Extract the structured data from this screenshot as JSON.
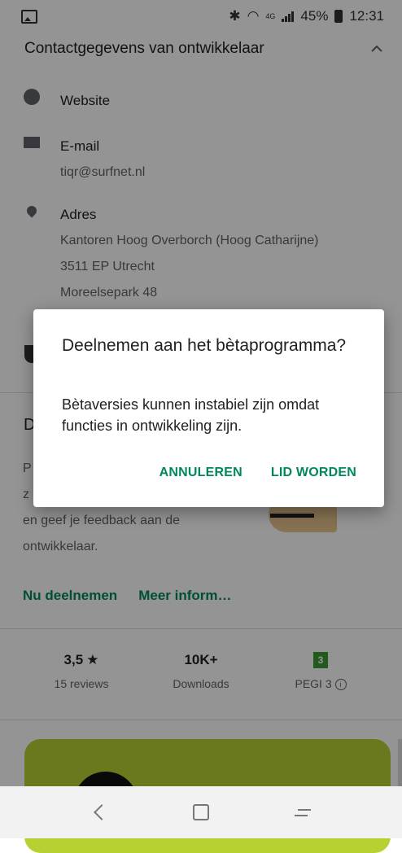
{
  "status_bar": {
    "time": "12:31",
    "battery_percent": "45%",
    "network_type": "4G"
  },
  "contact": {
    "section_title": "Contactgegevens van ontwikkelaar",
    "website_label": "Website",
    "email_label": "E-mail",
    "email_value": "tiqr@surfnet.nl",
    "address_label": "Adres",
    "address_lines": [
      "Kantoren Hoog Overborch (Hoog Catharijne)",
      "3511 EP Utrecht",
      "Moreelsepark 48"
    ]
  },
  "beta": {
    "title_partial": "D",
    "text_lines": [
      "P",
      "z",
      "en geef je feedback aan de",
      "ontwikkelaar."
    ],
    "join_link": "Nu deelnemen",
    "more_link": "Meer inform…"
  },
  "stats": [
    {
      "value": "3,5",
      "label": "15 reviews",
      "icon": "star-icon"
    },
    {
      "value": "10K+",
      "label": "Downloads"
    },
    {
      "value": "3",
      "label": "PEGI 3",
      "icon": "info-icon"
    }
  ],
  "dialog": {
    "title": "Deelnemen aan het bètaprogramma?",
    "body": "Bètaversies kunnen instabiel zijn omdat functies in ontwikkeling zijn.",
    "cancel_label": "ANNULEREN",
    "confirm_label": "LID WORDEN"
  },
  "colors": {
    "accent": "#01875f",
    "promo": "#b7d133",
    "scrim": "rgba(0,0,0,0.42)"
  }
}
